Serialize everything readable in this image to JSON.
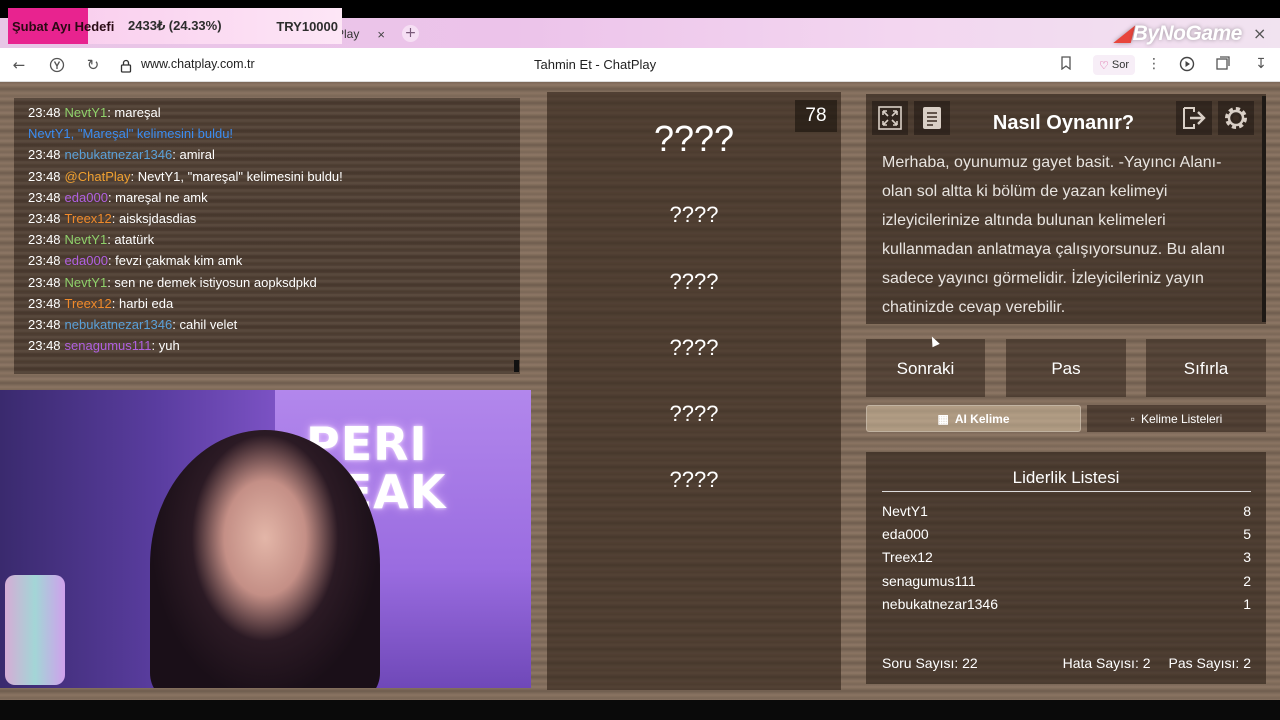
{
  "browser": {
    "tab_title": "Play",
    "tab_close": "×",
    "new_tab": "+",
    "brand_mark": "◢",
    "brand_name": "ByNoGame",
    "window_close": "×",
    "url": "www.chatplay.com.tr",
    "page_title": "Tahmin Et - ChatPlay",
    "sor_label": "Sor",
    "icons": [
      "back-icon",
      "yandex-icon",
      "reload-icon",
      "lock-icon",
      "bookmark-icon",
      "heart-icon",
      "more-icon",
      "play-icon",
      "collections-icon",
      "download-icon"
    ]
  },
  "goal_overlay": {
    "title": "Şubat Ayı Hedefi",
    "progress": "2433₺ (24.33%)",
    "target": "TRY10000",
    "percent": 24.33,
    "accent": "#e8238f"
  },
  "chat": {
    "messages": [
      {
        "time": "23:48",
        "user": "NevtY1",
        "text": ": mareşal",
        "color": "#8fd16b"
      },
      {
        "time": "",
        "user": "",
        "text": "NevtY1, \"Mareşal\" kelimesini buldu!",
        "color": "#3b8cf0",
        "system": true
      },
      {
        "time": "23:48",
        "user": "nebukatnezar1346",
        "text": ": amiral",
        "color": "#5aa0d8"
      },
      {
        "time": "23:48",
        "user": "@ChatPlay",
        "text": ": NevtY1, \"mareşal\" kelimesini buldu!",
        "color": "#f0a030"
      },
      {
        "time": "23:48",
        "user": "eda000",
        "text": ": mareşal ne amk",
        "color": "#b060e0"
      },
      {
        "time": "23:48",
        "user": "Treex12",
        "text": ": aisksjdasdias",
        "color": "#f08a2a"
      },
      {
        "time": "23:48",
        "user": "NevtY1",
        "text": ": atatürk",
        "color": "#8fd16b"
      },
      {
        "time": "23:48",
        "user": "eda000",
        "text": ": fevzi çakmak kim amk",
        "color": "#b060e0"
      },
      {
        "time": "23:48",
        "user": "NevtY1",
        "text": ": sen ne demek istiyosun aopksdpkd",
        "color": "#8fd16b"
      },
      {
        "time": "23:48",
        "user": "Treex12",
        "text": ": harbi eda",
        "color": "#f08a2a"
      },
      {
        "time": "23:48",
        "user": "nebukatnezar1346",
        "text": ": cahil velet",
        "color": "#5aa0d8"
      },
      {
        "time": "23:48",
        "user": "senagumus111",
        "text": ": yuh",
        "color": "#b060e0"
      }
    ]
  },
  "webcam": {
    "sign_line1": "PERI",
    "sign_line2": "PEAK"
  },
  "game": {
    "counter": "78",
    "words": [
      "????",
      "????",
      "????",
      "????",
      "????",
      "????"
    ]
  },
  "howto": {
    "title": "Nasıl Oynanır?",
    "text": "Merhaba, oyunumuz gayet basit. -Yayıncı Alanı- olan sol altta ki bölüm de yazan kelimeyi izleyicilerinize altında bulunan kelimeleri kullanmadan anlatmaya çalışıyorsunuz. Bu alanı sadece yayıncı görmelidir. İzleyicileriniz yayın chatinizde cevap verebilir.",
    "icons": [
      "fullscreen-icon",
      "notes-icon",
      "exit-icon",
      "settings-icon"
    ]
  },
  "actions": {
    "next": "Sonraki",
    "pass": "Pas",
    "reset": "Sıfırla",
    "ai_word": "AI Kelime",
    "word_lists": "Kelime Listeleri"
  },
  "leaderboard": {
    "title": "Liderlik Listesi",
    "rows": [
      {
        "name": "NevtY1",
        "score": "8"
      },
      {
        "name": "eda000",
        "score": "5"
      },
      {
        "name": "Treex12",
        "score": "3"
      },
      {
        "name": "senagumus111",
        "score": "2"
      },
      {
        "name": "nebukatnezar1346",
        "score": "1"
      }
    ],
    "question_count": "Soru Sayısı: 22",
    "error_count": "Hata Sayısı: 2",
    "pass_count": "Pas Sayısı: 2"
  }
}
